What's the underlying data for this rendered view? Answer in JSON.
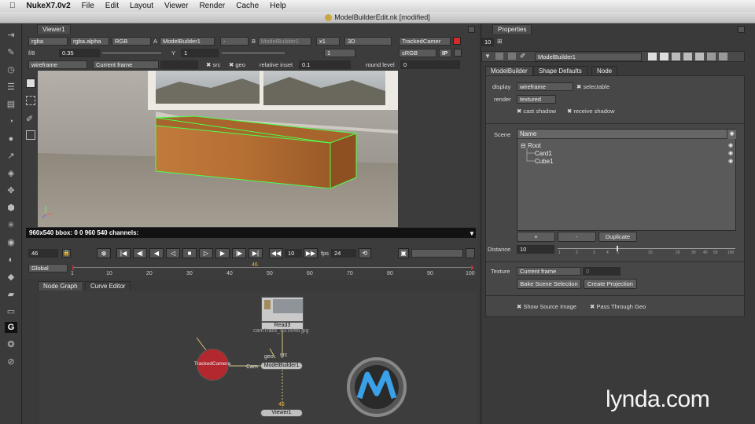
{
  "menubar": {
    "apple": "",
    "app_name": "NukeX7.0v2",
    "items": [
      "File",
      "Edit",
      "Layout",
      "Viewer",
      "Render",
      "Cache",
      "Help"
    ]
  },
  "window_title": "ModelBuilderEdit.nk [modified]",
  "viewer": {
    "tab": "Viewer1",
    "row1": {
      "channels": "rgba",
      "alpha": "rgba.alpha",
      "display": "RGB",
      "a_label": "A",
      "a_input": "ModelBuilder1",
      "op": "-",
      "b_label": "B",
      "b_input": "ModelBuilder1",
      "zoom": "x1",
      "view_mode": "3D",
      "camera": "TrackedCamer"
    },
    "row2": {
      "f_label": "f/8",
      "gain": "0.35",
      "y_label": "Y",
      "gamma": "1",
      "proxy": "1",
      "lut": "sRGB",
      "ip": "IP"
    },
    "row3": {
      "render_mode": "wireframe",
      "frame_mode": "Current frame",
      "src_label": "src",
      "geo_label": "geo",
      "relative_inset_label": "relative inset",
      "relative_inset_value": "0.1",
      "round_level_label": "round level",
      "round_level_value": "0"
    },
    "status": "960x540 bbox: 0 0 960 540 channels:",
    "timeline": {
      "frame": "46",
      "step": "10",
      "fps_label": "fps",
      "fps": "24",
      "range_mode": "Global",
      "ticks": [
        "1",
        "10",
        "20",
        "30",
        "40",
        "50",
        "60",
        "70",
        "80",
        "90",
        "100"
      ],
      "current_marker": "46",
      "end_frame": "100"
    }
  },
  "nodegraph": {
    "tabs": [
      "Node Graph",
      "Curve Editor"
    ],
    "nodes": {
      "read": "Read3",
      "read_file": "camTrack_v3.0046.jpg",
      "modelbuilder": "ModelBuilder1",
      "viewer": "Viewer1",
      "camera": "TrackedCamera",
      "input_geo": "geo",
      "input_src": "src",
      "input_cam": "Cam",
      "pipe_label": "46"
    }
  },
  "properties": {
    "title": "Properties",
    "max_panels": "10",
    "node_name": "ModelBuilder1",
    "tabs": [
      "ModelBuilder",
      "Shape Defaults",
      "Node"
    ],
    "display_label": "display",
    "display_value": "wireframe",
    "selectable_label": "selectable",
    "render_label": "render",
    "render_value": "textured",
    "cast_shadow_label": "cast shadow",
    "receive_shadow_label": "receive shadow",
    "scene_label": "Scene",
    "scene_header": "Name",
    "scene_items": [
      "Root",
      "Card1",
      "Cube1"
    ],
    "add_button": "+",
    "remove_button": "-",
    "duplicate_button": "Duplicate",
    "distance_label": "Distance",
    "distance_value": "10",
    "distance_ticks": [
      "1",
      "2",
      "3",
      "4",
      "5",
      "10",
      "20",
      "30",
      "40",
      "50",
      "100"
    ],
    "texture_label": "Texture",
    "texture_value": "Current frame",
    "texture_frame": "0",
    "bake_button": "Bake Scene Selection",
    "projection_button": "Create Projection",
    "show_source_label": "Show Source Image",
    "pass_through_label": "Pass Through Geo"
  },
  "watermark": "lynda.com"
}
